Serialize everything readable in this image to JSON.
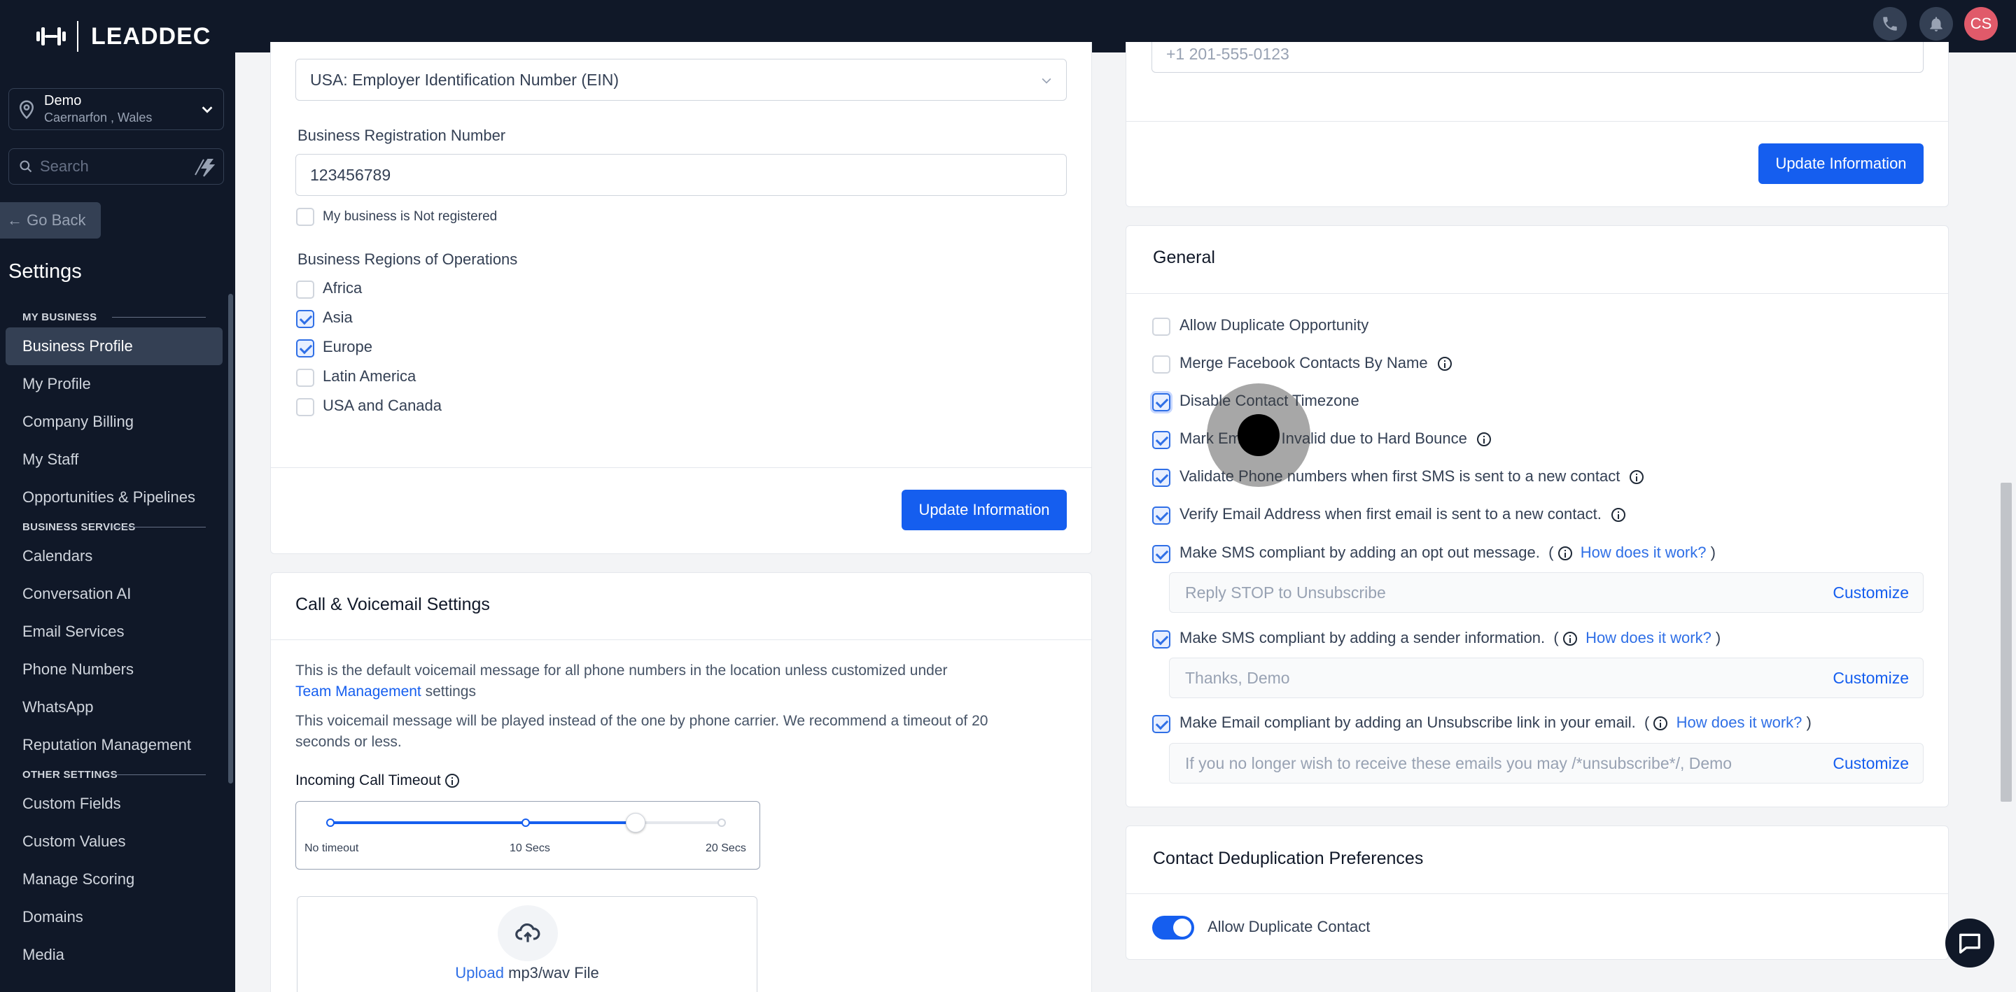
{
  "brand": {
    "name": "LEADDEC"
  },
  "location": {
    "name": "Demo",
    "address": "Caernarfon , Wales"
  },
  "sidebar_search": {
    "placeholder": "Search"
  },
  "go_back": "Go Back",
  "settings_title": "Settings",
  "nav": {
    "section_my_business": "MY BUSINESS",
    "my_business": [
      "Business Profile",
      "My Profile",
      "Company Billing",
      "My Staff",
      "Opportunities & Pipelines"
    ],
    "section_business_services": "BUSINESS SERVICES",
    "business_services": [
      "Calendars",
      "Conversation AI",
      "Email Services",
      "Phone Numbers",
      "WhatsApp",
      "Reputation Management"
    ],
    "section_other_settings": "OTHER SETTINGS",
    "other_settings": [
      "Custom Fields",
      "Custom Values",
      "Manage Scoring",
      "Domains",
      "Media"
    ]
  },
  "topbar": {
    "avatar_initials": "CS"
  },
  "business_info": {
    "id_type": "USA: Employer Identification Number (EIN)",
    "reg_label": "Business Registration Number",
    "reg_value": "123456789",
    "not_registered": {
      "label": "My business is Not registered",
      "checked": false
    },
    "regions_label": "Business Regions of Operations",
    "regions": [
      {
        "label": "Africa",
        "checked": false
      },
      {
        "label": "Asia",
        "checked": true
      },
      {
        "label": "Europe",
        "checked": true
      },
      {
        "label": "Latin America",
        "checked": false
      },
      {
        "label": "USA and Canada",
        "checked": false
      }
    ],
    "update_button": "Update Information"
  },
  "call_voicemail": {
    "title": "Call & Voicemail Settings",
    "desc1": "This is the default voicemail message for all phone numbers in the location unless customized under",
    "desc1_link": "Team Management",
    "desc1_tail": "settings",
    "desc2": "This voicemail message will be played instead of the one by phone carrier. We recommend a timeout of 20",
    "desc2_tail": "seconds or less.",
    "timeout_label": "Incoming Call Timeout",
    "slider": {
      "min_label": "No timeout",
      "mid_label": "10 Secs",
      "max_label": "20 Secs",
      "value_fraction": 0.78
    },
    "upload_link": "Upload",
    "upload_text": "mp3/wav File"
  },
  "contact_info": {
    "phone": "+1 201-555-0123",
    "update_button": "Update Information"
  },
  "general": {
    "title": "General",
    "options": [
      {
        "label": "Allow Duplicate Opportunity",
        "checked": false,
        "info": false
      },
      {
        "label": "Merge Facebook Contacts By Name",
        "checked": false,
        "info": true
      },
      {
        "label": "Disable Contact Timezone",
        "checked": true,
        "info": false
      },
      {
        "label": "Mark Email as Invalid due to Hard Bounce",
        "checked": true,
        "info": true
      },
      {
        "label": "Validate Phone numbers when first SMS is sent to a new contact",
        "checked": true,
        "info": true
      },
      {
        "label": "Verify Email Address when first email is sent to a new contact.",
        "checked": true,
        "info": true
      }
    ],
    "compliance": [
      {
        "label": "Make SMS compliant by adding an opt out message.",
        "checked": true,
        "link": "How does it work?",
        "placeholder": "Reply STOP to Unsubscribe",
        "customize": "Customize"
      },
      {
        "label": "Make SMS compliant by adding a sender information.",
        "checked": true,
        "link": "How does it work?",
        "placeholder": "Thanks, Demo",
        "customize": "Customize"
      },
      {
        "label": "Make Email compliant by adding an Unsubscribe link in your email.",
        "checked": true,
        "link": "How does it work?",
        "placeholder": "If you no longer wish to receive these emails you may /*unsubscribe*/, Demo",
        "customize": "Customize"
      }
    ]
  },
  "dedup": {
    "title": "Contact Deduplication Preferences",
    "toggle_label": "Allow Duplicate Contact",
    "toggle_on": true
  }
}
